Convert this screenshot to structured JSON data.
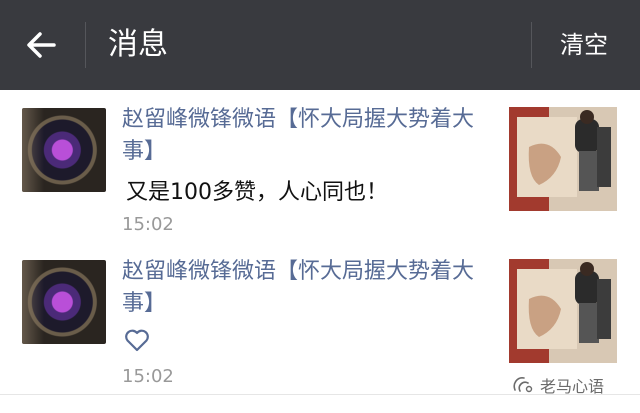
{
  "topbar": {
    "title": "消息",
    "clear_label": "清空",
    "back_icon": "arrow-left-icon"
  },
  "messages": [
    {
      "sender": "赵留峰微锋微语【怀大局握大势着大事】",
      "content": "又是100多赞，人心同也！",
      "time": "15:02",
      "type": "comment"
    },
    {
      "sender": "赵留峰微锋微语【怀大局握大势着大事】",
      "content": "",
      "time": "15:02",
      "type": "like",
      "icon": "heart-outline-icon"
    }
  ],
  "watermark": {
    "text": "老马心语",
    "icon": "wechat-channel-icon"
  }
}
